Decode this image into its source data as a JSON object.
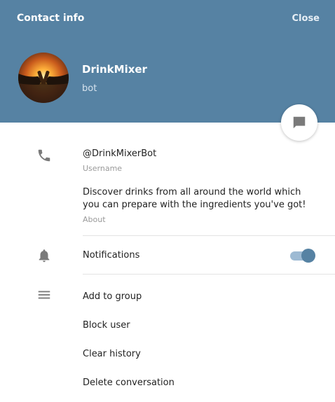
{
  "header": {
    "title": "Contact info",
    "close_label": "Close",
    "background": "#5682a3"
  },
  "contact": {
    "name": "DrinkMixer",
    "status": "bot"
  },
  "details": {
    "username_value": "@DrinkMixerBot",
    "username_caption": "Username",
    "about_value": "Discover drinks from all around the world which you can prepare with the ingredients you've got!",
    "about_caption": "About"
  },
  "notifications": {
    "label": "Notifications",
    "enabled": true
  },
  "actions": {
    "add_to_group": "Add to group",
    "block_user": "Block user",
    "clear_history": "Clear history",
    "delete_conversation": "Delete conversation"
  },
  "icons": {
    "phone": "phone-icon",
    "bell": "bell-icon",
    "menu": "menu-icon",
    "message": "message-icon"
  }
}
